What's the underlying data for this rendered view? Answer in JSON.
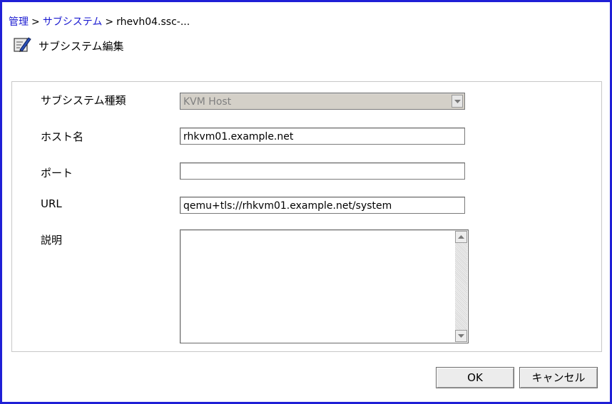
{
  "breadcrumb": {
    "items": [
      "管理",
      "サブシステム"
    ],
    "separator": ">",
    "current": "rhevh04.ssc-..."
  },
  "page": {
    "title": "サブシステム編集",
    "icon": "edit-form-icon"
  },
  "form": {
    "subsystem_type": {
      "label": "サブシステム種類",
      "value": "KVM Host"
    },
    "hostname": {
      "label": "ホスト名",
      "value": "rhkvm01.example.net"
    },
    "port": {
      "label": "ポート",
      "value": ""
    },
    "url": {
      "label": "URL",
      "value": "qemu+tls://rhkvm01.example.net/system"
    },
    "description": {
      "label": "説明",
      "value": ""
    }
  },
  "buttons": {
    "ok": "OK",
    "cancel": "キャンセル"
  },
  "colors": {
    "window_border": "#1f1fd6",
    "link": "#1a1ad0",
    "disabled_bg": "#d4d0c8"
  }
}
